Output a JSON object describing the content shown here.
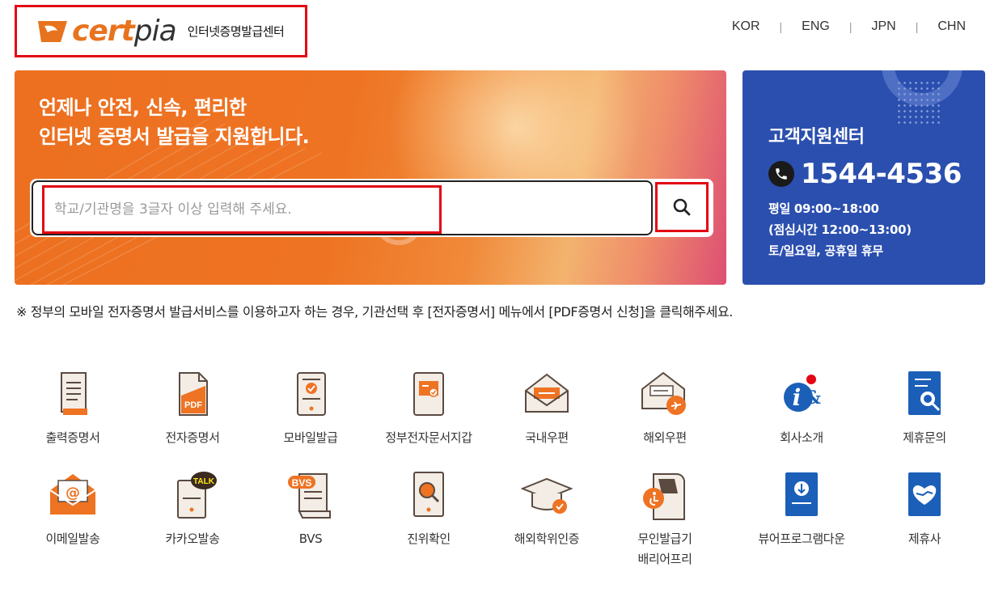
{
  "header": {
    "logo_text_cert": "cert",
    "logo_text_pia": "pia",
    "logo_subtitle": "인터넷증명발급센터",
    "languages": [
      "KOR",
      "ENG",
      "JPN",
      "CHN"
    ]
  },
  "hero": {
    "title_line1": "언제나 안전, 신속, 편리한",
    "title_line2": "인터넷 증명서 발급을 지원합니다.",
    "search_placeholder": "학교/기관명을 3글자 이상 입력해 주세요."
  },
  "support": {
    "title": "고객지원센터",
    "phone": "1544-4536",
    "hours_line1": "평일 09:00~18:00",
    "hours_line2": "(점심시간 12:00~13:00)",
    "hours_line3": "토/일요일, 공휴일 휴무"
  },
  "notice": "※ 정부의 모바일 전자증명서 발급서비스를 이용하고자 하는 경우, 기관선택 후 [전자증명서] 메뉴에서 [PDF증명서 신청]을 클릭해주세요.",
  "menu": {
    "row1": [
      {
        "label": "출력증명서",
        "icon": "printed-certificate-icon"
      },
      {
        "label": "전자증명서",
        "icon": "pdf-certificate-icon"
      },
      {
        "label": "모바일발급",
        "icon": "mobile-issue-icon"
      },
      {
        "label": "정부전자문서지갑",
        "icon": "gov-wallet-icon"
      },
      {
        "label": "국내우편",
        "icon": "domestic-mail-icon"
      },
      {
        "label": "해외우편",
        "icon": "overseas-mail-icon"
      },
      {
        "label": "회사소개",
        "icon": "company-info-icon"
      },
      {
        "label": "제휴문의",
        "icon": "partnership-inquiry-icon"
      }
    ],
    "row2": [
      {
        "label": "이메일발송",
        "icon": "email-icon"
      },
      {
        "label": "카카오발송",
        "icon": "kakao-talk-icon"
      },
      {
        "label": "BVS",
        "icon": "bvs-icon"
      },
      {
        "label": "진위확인",
        "icon": "authenticity-check-icon"
      },
      {
        "label": "해외학위인증",
        "icon": "degree-certification-icon"
      },
      {
        "label": "무인발급기\n배리어프리",
        "icon": "kiosk-barrier-free-icon"
      },
      {
        "label": "뷰어프로그램다운",
        "icon": "viewer-download-icon"
      },
      {
        "label": "제휴사",
        "icon": "partners-icon"
      }
    ]
  },
  "colors": {
    "accent": "#ee7322",
    "support_bg": "#2b4fae",
    "highlight_border": "#e30613"
  }
}
